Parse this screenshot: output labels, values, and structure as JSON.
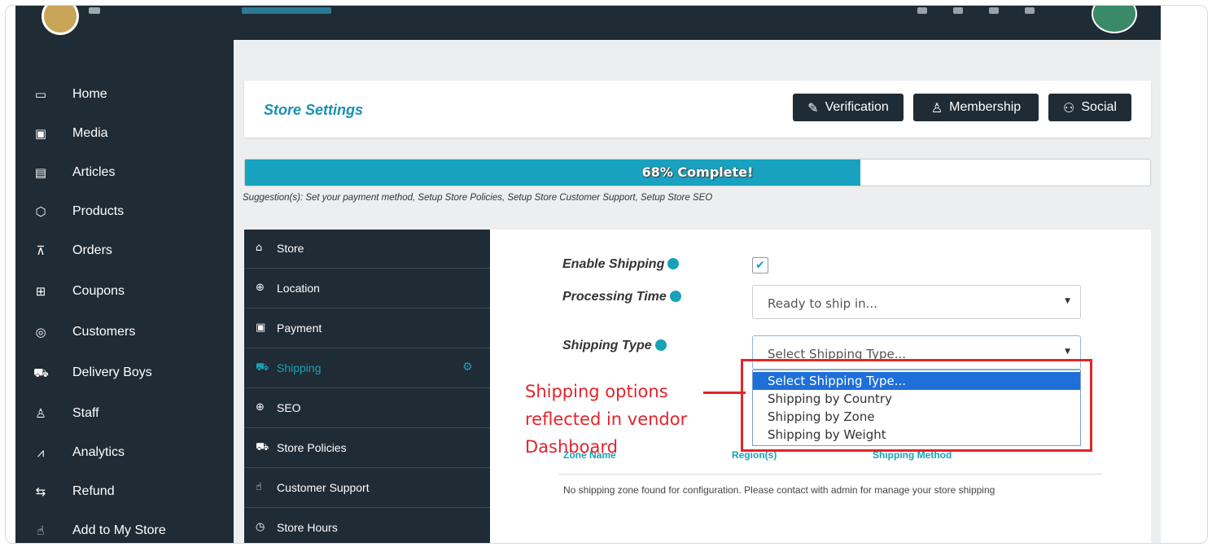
{
  "top": {
    "breadcrumb_icon": "gear-icon"
  },
  "sidebar": {
    "items": [
      {
        "label": "Home",
        "icon": "home-icon",
        "glyph": "▭"
      },
      {
        "label": "Media",
        "icon": "image-icon",
        "glyph": "▣"
      },
      {
        "label": "Articles",
        "icon": "document-icon",
        "glyph": "▤"
      },
      {
        "label": "Products",
        "icon": "cube-icon",
        "glyph": "⬡"
      },
      {
        "label": "Orders",
        "icon": "cart-icon",
        "glyph": "⊼"
      },
      {
        "label": "Coupons",
        "icon": "gift-icon",
        "glyph": "⊞"
      },
      {
        "label": "Customers",
        "icon": "user-circle-icon",
        "glyph": "◎"
      },
      {
        "label": "Delivery Boys",
        "icon": "truck-icon",
        "glyph": "⛟"
      },
      {
        "label": "Staff",
        "icon": "user-icon",
        "glyph": "♙"
      },
      {
        "label": "Analytics",
        "icon": "chart-icon",
        "glyph": "⩘"
      },
      {
        "label": "Refund",
        "icon": "refund-icon",
        "glyph": "⇆"
      },
      {
        "label": "Add to My Store",
        "icon": "hand-pointer-icon",
        "glyph": "☝"
      }
    ]
  },
  "header": {
    "title": "Store Settings",
    "buttons": [
      {
        "label": "Verification",
        "icon": "medal-icon",
        "glyph": "✎"
      },
      {
        "label": "Membership",
        "icon": "user-plus-icon",
        "glyph": "♙"
      },
      {
        "label": "Social",
        "icon": "users-icon",
        "glyph": "⚇"
      }
    ]
  },
  "progress": {
    "percent": 68,
    "label": "68% Complete!"
  },
  "suggestion": "Suggestion(s): Set your payment method, Setup Store Policies, Setup Store Customer Support, Setup Store SEO",
  "tabs": [
    {
      "label": "Store",
      "icon": "bag-icon",
      "glyph": "⌂"
    },
    {
      "label": "Location",
      "icon": "globe-icon",
      "glyph": "⊕"
    },
    {
      "label": "Payment",
      "icon": "money-icon",
      "glyph": "▣"
    },
    {
      "label": "Shipping",
      "icon": "truck-icon",
      "glyph": "⛟",
      "active": true
    },
    {
      "label": "SEO",
      "icon": "globe-icon",
      "glyph": "⊕"
    },
    {
      "label": "Store Policies",
      "icon": "truck-icon",
      "glyph": "⛟"
    },
    {
      "label": "Customer Support",
      "icon": "thumbs-up-icon",
      "glyph": "☝"
    },
    {
      "label": "Store Hours",
      "icon": "clock-icon",
      "glyph": "◷"
    }
  ],
  "form": {
    "enable_shipping_label": "Enable Shipping",
    "enable_shipping_checked": true,
    "processing_time_label": "Processing Time",
    "processing_time_value": "Ready to ship in...",
    "shipping_type_label": "Shipping Type",
    "shipping_type_value": "Select Shipping Type...",
    "shipping_type_options": [
      "Select Shipping Type...",
      "Shipping by Country",
      "Shipping by Zone",
      "Shipping by Weight"
    ]
  },
  "zones": {
    "headers": [
      "Zone Name",
      "Region(s)",
      "Shipping Method"
    ],
    "empty_message": "No shipping zone found for configuration. Please contact with admin for manage your store shipping"
  },
  "annotation": {
    "text": "Shipping options reflected in vendor Dashboard",
    "color": "#e3242b"
  },
  "colors": {
    "accent": "#17a2b8",
    "dark": "#1f2b35",
    "highlight": "#1e6fd9"
  }
}
